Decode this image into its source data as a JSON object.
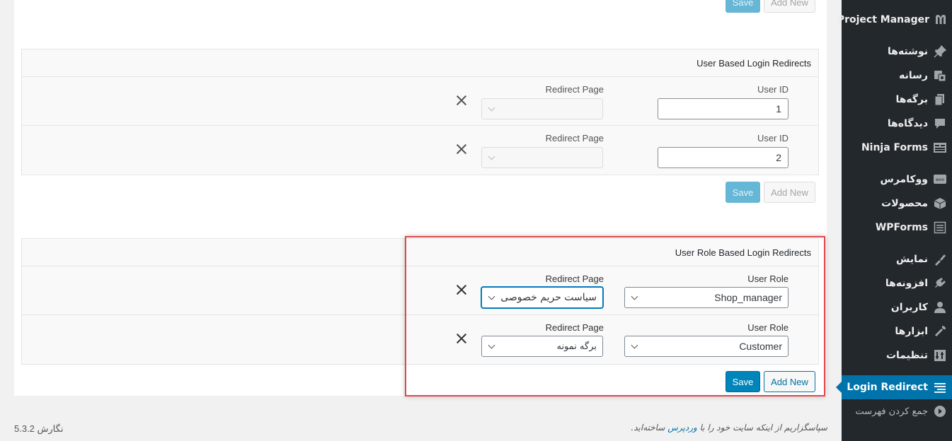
{
  "top_buttons": {
    "save": "Save",
    "add_new": "Add New"
  },
  "user_section": {
    "title": "User Based Login Redirects",
    "rows": [
      {
        "user_id_label": "User ID",
        "user_id_value": "1",
        "redirect_label": "Redirect Page",
        "redirect_value": ""
      },
      {
        "user_id_label": "User ID",
        "user_id_value": "2",
        "redirect_label": "Redirect Page",
        "redirect_value": ""
      }
    ],
    "save": "Save",
    "add_new": "Add New"
  },
  "role_section": {
    "title": "User Role Based Login Redirects",
    "rows": [
      {
        "role_label": "User Role",
        "role_value": "Shop_manager",
        "redirect_label": "Redirect Page",
        "redirect_value": "سیاست حریم خصوصی"
      },
      {
        "role_label": "User Role",
        "role_value": "Customer",
        "redirect_label": "Redirect Page",
        "redirect_value": "برگه نمونه"
      }
    ],
    "save": "Save",
    "add_new": "Add New"
  },
  "sidebar": {
    "items": [
      {
        "label": "Project Manager",
        "icon": "project-manager-icon"
      },
      {
        "label": "نوشته‌ها",
        "icon": "pin-icon"
      },
      {
        "label": "رسانه",
        "icon": "media-icon"
      },
      {
        "label": "برگه‌ها",
        "icon": "pages-icon"
      },
      {
        "label": "دیدگاه‌ها",
        "icon": "comments-icon"
      },
      {
        "label": "Ninja Forms",
        "icon": "ninja-forms-icon"
      },
      {
        "label": "ووکامرس",
        "icon": "woocommerce-icon"
      },
      {
        "label": "محصولات",
        "icon": "products-icon"
      },
      {
        "label": "WPForms",
        "icon": "wpforms-icon"
      },
      {
        "label": "نمایش",
        "icon": "appearance-icon"
      },
      {
        "label": "افزونه‌ها",
        "icon": "plugins-icon"
      },
      {
        "label": "کاربران",
        "icon": "users-icon"
      },
      {
        "label": "ابزارها",
        "icon": "tools-icon"
      },
      {
        "label": "تنظیمات",
        "icon": "settings-icon"
      },
      {
        "label": "Login Redirect",
        "icon": "login-redirect-icon"
      },
      {
        "label": "جمع کردن فهرست",
        "icon": "collapse-icon"
      }
    ]
  },
  "footer": {
    "version": "نگارش 5.3.2",
    "thanks_pre": "سپاسگزاریم از اینکه سایت خود را با",
    "thanks_link": "وردپرس",
    "thanks_post": "ساخته‌اید."
  },
  "colors": {
    "accent": "#0073aa",
    "highlight": "#e2474b",
    "sidebar": "#23282d"
  }
}
